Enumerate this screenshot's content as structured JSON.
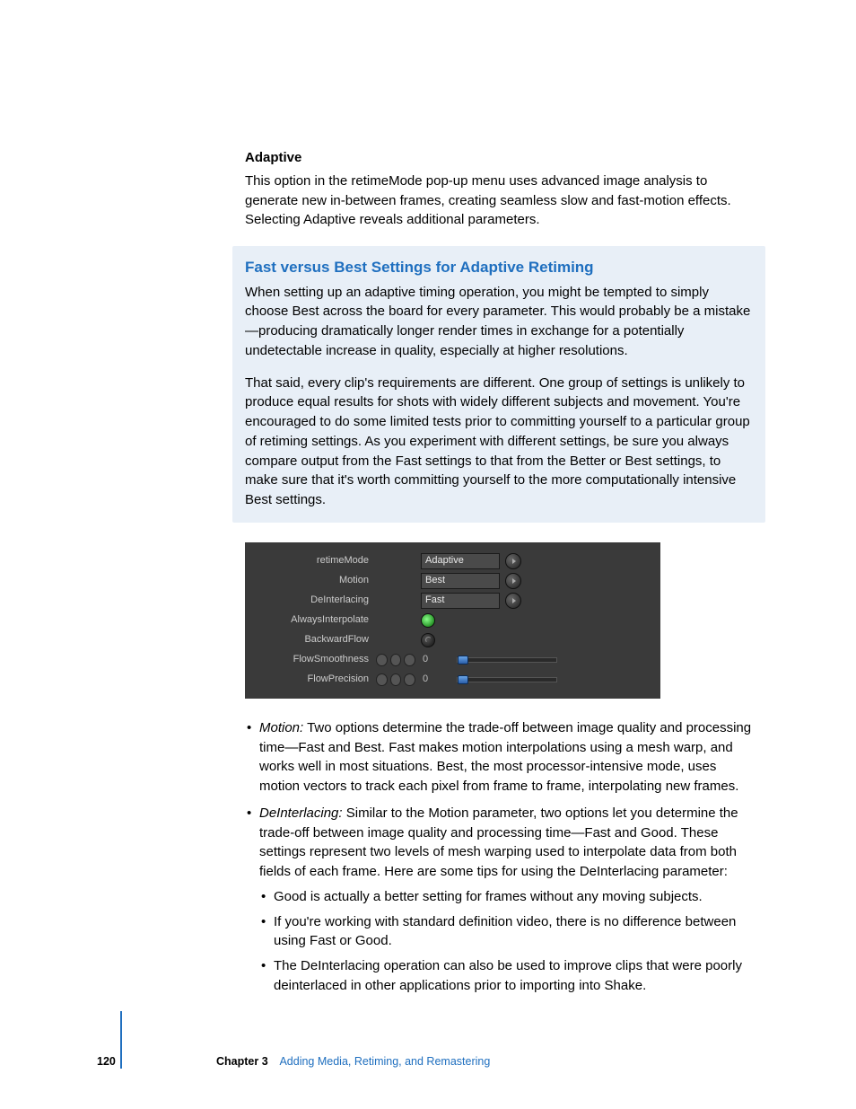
{
  "heading1": "Adaptive",
  "intro_para": "This option in the retimeMode pop-up menu uses advanced image analysis to generate new in-between frames, creating seamless slow and fast-motion effects. Selecting Adaptive reveals additional parameters.",
  "callout": {
    "heading": "Fast versus Best Settings for Adaptive Retiming",
    "p1": "When setting up an adaptive timing operation, you might be tempted to simply choose Best across the board for every parameter. This would probably be a mistake—producing dramatically longer render times in exchange for a potentially undetectable increase in quality, especially at higher resolutions.",
    "p2": "That said, every clip's requirements are different. One group of settings is unlikely to produce equal results for shots with widely different subjects and movement. You're encouraged to do some limited tests prior to committing yourself to a particular group of retiming settings. As you experiment with different settings, be sure you always compare output from the Fast settings to that from the Better or Best settings, to make sure that it's worth committing yourself to the more computationally intensive Best settings."
  },
  "panel": {
    "rows": {
      "retimeMode": {
        "label": "retimeMode",
        "value": "Adaptive"
      },
      "motion": {
        "label": "Motion",
        "value": "Best"
      },
      "deinterlacing": {
        "label": "DeInterlacing",
        "value": "Fast"
      },
      "alwaysInterpolate": {
        "label": "AlwaysInterpolate",
        "on": true
      },
      "backwardFlow": {
        "label": "BackwardFlow",
        "on": false
      },
      "flowSmoothness": {
        "label": "FlowSmoothness",
        "value": "0"
      },
      "flowPrecision": {
        "label": "FlowPrecision",
        "value": "0"
      }
    }
  },
  "bullets": {
    "motion": {
      "term": "Motion:",
      "text": "  Two options determine the trade-off between image quality and processing time—Fast and Best. Fast makes motion interpolations using a mesh warp, and works well in most situations. Best, the most processor-intensive mode, uses motion vectors to track each pixel from frame to frame, interpolating new frames."
    },
    "deinterlacing": {
      "term": "DeInterlacing:",
      "text": "  Similar to the Motion parameter, two options let you determine the trade-off between image quality and processing time—Fast and Good. These settings represent two levels of mesh warping used to interpolate data from both fields of each frame. Here are some tips for using the DeInterlacing parameter:",
      "sub": [
        "Good is actually a better setting for frames without any moving subjects.",
        "If you're working with standard definition video, there is no difference between using Fast or Good.",
        "The DeInterlacing operation can also be used to improve clips that were poorly deinterlaced in other applications prior to importing into Shake."
      ]
    }
  },
  "footer": {
    "page_number": "120",
    "chapter_label": "Chapter 3",
    "chapter_title": "Adding Media, Retiming, and Remastering"
  }
}
